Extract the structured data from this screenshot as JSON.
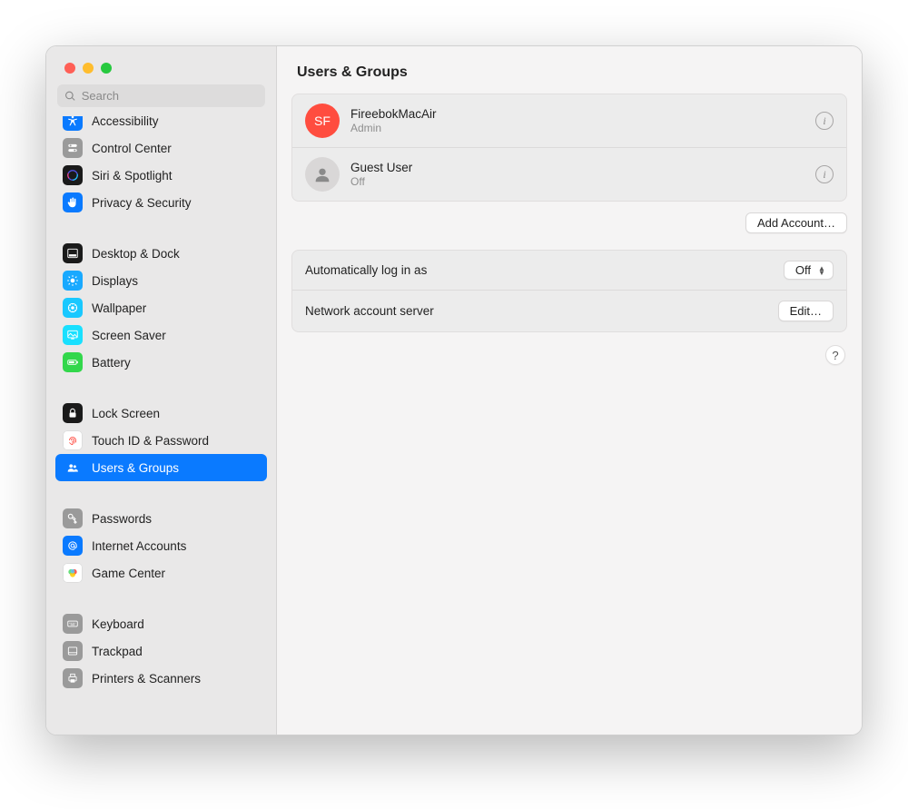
{
  "window": {
    "title": "Users & Groups"
  },
  "search": {
    "placeholder": "Search"
  },
  "sidebar": {
    "groups": [
      [
        {
          "label": "Accessibility",
          "icon": "accessibility",
          "bg": "#0a7aff"
        },
        {
          "label": "Control Center",
          "icon": "control-center",
          "bg": "#9a9a9a"
        },
        {
          "label": "Siri & Spotlight",
          "icon": "siri",
          "bg": "#1a1a1a"
        },
        {
          "label": "Privacy & Security",
          "icon": "hand",
          "bg": "#0a7aff"
        }
      ],
      [
        {
          "label": "Desktop & Dock",
          "icon": "dock",
          "bg": "#1a1a1a"
        },
        {
          "label": "Displays",
          "icon": "displays",
          "bg": "#19a9ff"
        },
        {
          "label": "Wallpaper",
          "icon": "wallpaper",
          "bg": "#19c8ff"
        },
        {
          "label": "Screen Saver",
          "icon": "screensaver",
          "bg": "#19e0ff"
        },
        {
          "label": "Battery",
          "icon": "battery",
          "bg": "#32d74b"
        }
      ],
      [
        {
          "label": "Lock Screen",
          "icon": "lock",
          "bg": "#1a1a1a"
        },
        {
          "label": "Touch ID & Password",
          "icon": "fingerprint",
          "bg": "#ffffff",
          "fg": "#ff3b30",
          "border": true
        },
        {
          "label": "Users & Groups",
          "icon": "users",
          "bg": "#0a7aff",
          "selected": true
        }
      ],
      [
        {
          "label": "Passwords",
          "icon": "key",
          "bg": "#9a9a9a"
        },
        {
          "label": "Internet Accounts",
          "icon": "at",
          "bg": "#0a7aff"
        },
        {
          "label": "Game Center",
          "icon": "gamecenter",
          "bg": "#ffffff",
          "border": true
        }
      ],
      [
        {
          "label": "Keyboard",
          "icon": "keyboard",
          "bg": "#9a9a9a"
        },
        {
          "label": "Trackpad",
          "icon": "trackpad",
          "bg": "#9a9a9a"
        },
        {
          "label": "Printers & Scanners",
          "icon": "printer",
          "bg": "#9a9a9a"
        }
      ]
    ]
  },
  "users": [
    {
      "name": "FireebokMacAir",
      "role": "Admin",
      "initials": "SF",
      "avatar": "red"
    },
    {
      "name": "Guest User",
      "role": "Off",
      "avatar": "gray"
    }
  ],
  "add_account_label": "Add Account…",
  "settings": {
    "auto_login_label": "Automatically log in as",
    "auto_login_value": "Off",
    "network_server_label": "Network account server",
    "network_server_button": "Edit…"
  },
  "help_label": "?"
}
